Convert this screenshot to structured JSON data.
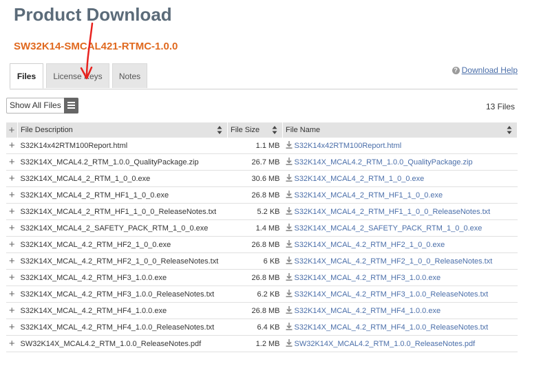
{
  "page": {
    "title": "Product Download",
    "product_code": "SW32K14-SMCAL421-RTMC-1.0.0"
  },
  "tabs": [
    {
      "label": "Files",
      "active": true
    },
    {
      "label": "License Keys",
      "active": false
    },
    {
      "label": "Notes",
      "active": false
    }
  ],
  "help": {
    "label": "Download Help",
    "icon": "question-circle-icon"
  },
  "toolbar": {
    "show_all_label": "Show All Files",
    "menu_icon": "hamburger-menu-icon",
    "file_count": "13 Files"
  },
  "table": {
    "columns": {
      "expand_icon": "plus-icon",
      "description": "File Description",
      "size": "File Size",
      "name": "File Name",
      "sort_icon": "sort-arrows-icon"
    },
    "rows": [
      {
        "description": "S32K14x42RTM100Report.html",
        "size": "1.1 MB",
        "name": "S32K14x42RTM100Report.html"
      },
      {
        "description": "S32K14X_MCAL4.2_RTM_1.0.0_QualityPackage.zip",
        "size": "26.7 MB",
        "name": "S32K14X_MCAL4.2_RTM_1.0.0_QualityPackage.zip"
      },
      {
        "description": "S32K14X_MCAL4_2_RTM_1_0_0.exe",
        "size": "30.6 MB",
        "name": "S32K14X_MCAL4_2_RTM_1_0_0.exe"
      },
      {
        "description": "S32K14X_MCAL4_2_RTM_HF1_1_0_0.exe",
        "size": "26.8 MB",
        "name": "S32K14X_MCAL4_2_RTM_HF1_1_0_0.exe"
      },
      {
        "description": "S32K14X_MCAL4_2_RTM_HF1_1_0_0_ReleaseNotes.txt",
        "size": "5.2 KB",
        "name": "S32K14X_MCAL4_2_RTM_HF1_1_0_0_ReleaseNotes.txt"
      },
      {
        "description": "S32K14X_MCAL4_2_SAFETY_PACK_RTM_1_0_0.exe",
        "size": "1.4 MB",
        "name": "S32K14X_MCAL4_2_SAFETY_PACK_RTM_1_0_0.exe"
      },
      {
        "description": "S32K14X_MCAL_4.2_RTM_HF2_1_0_0.exe",
        "size": "26.8 MB",
        "name": "S32K14X_MCAL_4.2_RTM_HF2_1_0_0.exe"
      },
      {
        "description": "S32K14X_MCAL_4.2_RTM_HF2_1_0_0_ReleaseNotes.txt",
        "size": "6 KB",
        "name": "S32K14X_MCAL_4.2_RTM_HF2_1_0_0_ReleaseNotes.txt"
      },
      {
        "description": "S32K14X_MCAL_4.2_RTM_HF3_1.0.0.exe",
        "size": "26.8 MB",
        "name": "S32K14X_MCAL_4.2_RTM_HF3_1.0.0.exe"
      },
      {
        "description": "S32K14X_MCAL_4.2_RTM_HF3_1.0.0_ReleaseNotes.txt",
        "size": "6.2 KB",
        "name": "S32K14X_MCAL_4.2_RTM_HF3_1.0.0_ReleaseNotes.txt"
      },
      {
        "description": "S32K14X_MCAL_4.2_RTM_HF4_1.0.0.exe",
        "size": "26.8 MB",
        "name": "S32K14X_MCAL_4.2_RTM_HF4_1.0.0.exe"
      },
      {
        "description": "S32K14X_MCAL_4.2_RTM_HF4_1.0.0_ReleaseNotes.txt",
        "size": "6.4 KB",
        "name": "S32K14X_MCAL_4.2_RTM_HF4_1.0.0_ReleaseNotes.txt"
      },
      {
        "description": "SW32K14X_MCAL4.2_RTM_1.0.0_ReleaseNotes.pdf",
        "size": "1.2 MB",
        "name": "SW32K14X_MCAL4.2_RTM_1.0.0_ReleaseNotes.pdf"
      }
    ],
    "row_icon": "download-arrow-icon"
  },
  "annotation": {
    "type": "red-arrow",
    "color": "#e8221e",
    "points_to": "License Keys tab"
  },
  "colors": {
    "title": "#5b6b79",
    "product_code": "#e0691f",
    "link": "#4a6ea9",
    "header_bg": "#e3e3e3"
  }
}
